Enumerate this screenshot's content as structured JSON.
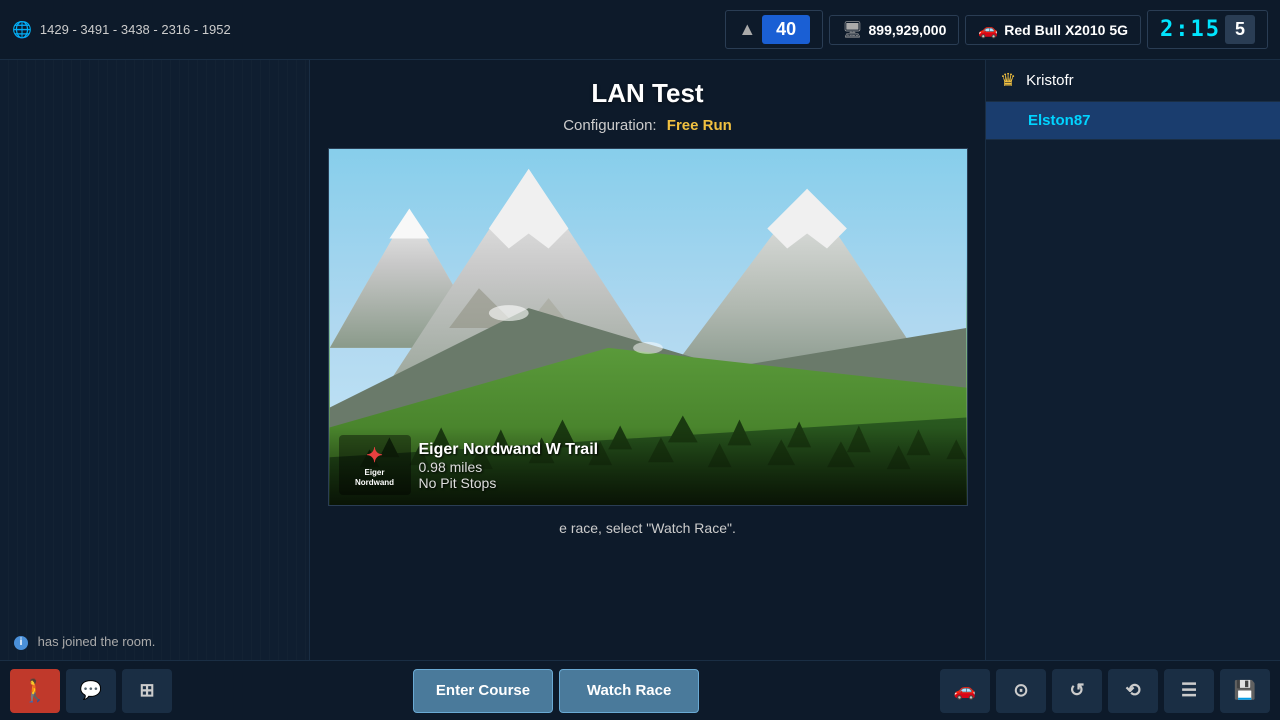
{
  "topbar": {
    "server_ids": "1429 - 3491 - 3438 - 2316 - 1952",
    "level": "40",
    "money": "899,929,000",
    "car": "Red Bull X2010 5G",
    "timer": "2:15",
    "lap": "5"
  },
  "session": {
    "title": "LAN Test",
    "config_label": "Configuration:",
    "config_value": "Free Run"
  },
  "track": {
    "name": "Eiger Nordwand W Trail",
    "distance": "0.98 miles",
    "pitstops": "No Pit Stops",
    "logo_text": "Eiger\nNordwand"
  },
  "instruction": {
    "text": "e race, select \"Watch Race\"."
  },
  "players": [
    {
      "name": "Kristofr",
      "is_host": true,
      "is_active": false
    },
    {
      "name": "Elston87",
      "is_host": false,
      "is_active": true
    }
  ],
  "chat": {
    "message": "has joined the room."
  },
  "buttons": {
    "enter_course": "Enter Course",
    "watch_race": "Watch Race"
  },
  "icons": {
    "exit": "🚶",
    "chat": "💬",
    "split": "⊞",
    "car": "🚗",
    "camera": "📷",
    "replay": "⟳",
    "settings": "⚙",
    "list": "☰",
    "save": "💾"
  }
}
